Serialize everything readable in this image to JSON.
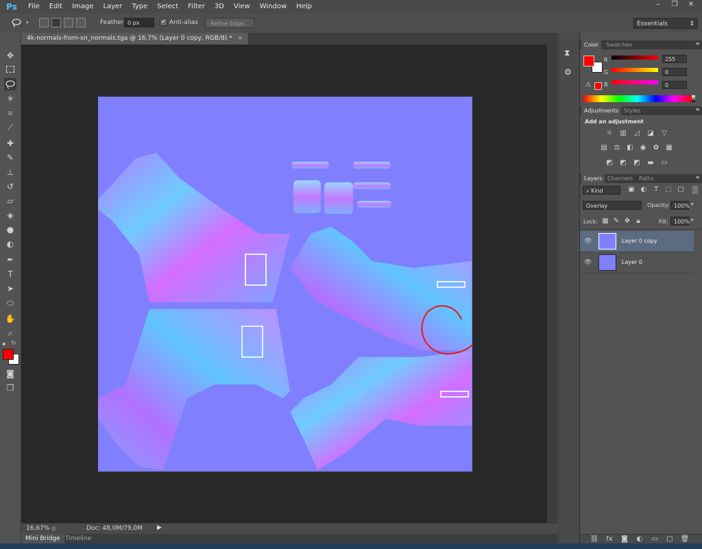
{
  "app": {
    "logo": "Ps"
  },
  "menu": [
    "File",
    "Edit",
    "Image",
    "Layer",
    "Type",
    "Select",
    "Filter",
    "3D",
    "View",
    "Window",
    "Help"
  ],
  "window_controls": [
    "‒",
    "❐",
    "✕"
  ],
  "options": {
    "feather_label": "Feather:",
    "feather_value": "0 px",
    "antialias_label": "Anti-alias",
    "refine_edge": "Refine Edge...",
    "workspace": "Essentials"
  },
  "document": {
    "tab_title": "4k-normals-from-xn_normals.tga @ 16,7% (Layer 0 copy, RGB/8) *",
    "close": "×",
    "zoom": "16,67%",
    "doc_size": "Doc: 48,0M/79,0M"
  },
  "bottom_tabs": [
    "Mini Bridge",
    "Timeline"
  ],
  "color_panel": {
    "tabs": [
      "Color",
      "Swatches"
    ],
    "r_label": "R",
    "r_value": "255",
    "g_label": "G",
    "g_value": "0",
    "b_label": "B",
    "b_value": "0",
    "foreground": "#ff0000",
    "background": "#ffffff"
  },
  "adjustments_panel": {
    "tabs": [
      "Adjustments",
      "Styles"
    ],
    "heading": "Add an adjustment"
  },
  "layers_panel": {
    "tabs": [
      "Layers",
      "Channels",
      "Paths"
    ],
    "kind": "Kind",
    "blend_mode": "Overlay",
    "opacity_label": "Opacity:",
    "opacity_value": "100%",
    "lock_label": "Lock:",
    "fill_label": "Fill:",
    "fill_value": "100%",
    "layers": [
      {
        "name": "Layer 0 copy",
        "selected": true
      },
      {
        "name": "Layer 0",
        "selected": false
      }
    ]
  },
  "colors": {
    "normal_map_base": "#8080ff",
    "selection_accent": "#5c6c80",
    "annotation_red": "#e0222a"
  }
}
